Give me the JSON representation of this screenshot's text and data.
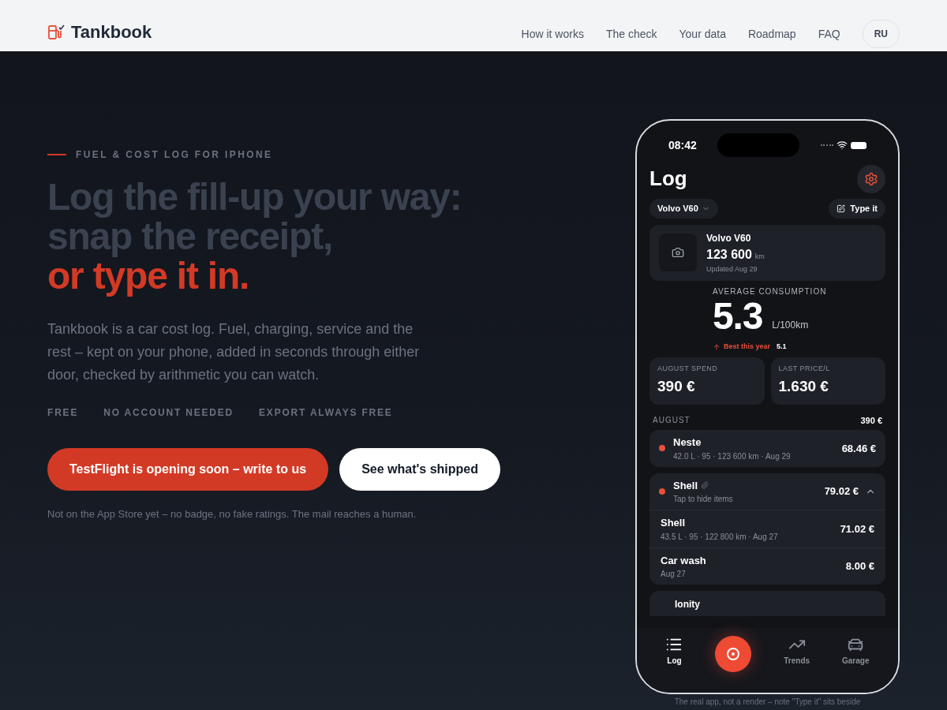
{
  "header": {
    "logo": "Tankbook",
    "nav": [
      "How it works",
      "The check",
      "Your data",
      "Roadmap",
      "FAQ"
    ],
    "language": "RU"
  },
  "hero": {
    "eyebrow": "FUEL & COST LOG FOR IPHONE",
    "headline": [
      {
        "text": "Log the fill-up your way:",
        "accent": false
      },
      {
        "text": "snap the receipt,",
        "accent": false
      },
      {
        "text": "or type it in.",
        "accent": true
      }
    ],
    "intro": "Tankbook is a car cost log. Fuel, charging, service and the rest – kept on your phone, added in seconds through either door, checked by arithmetic you can watch.",
    "features": [
      "FREE",
      "NO ACCOUNT NEEDED",
      "EXPORT ALWAYS FREE"
    ],
    "buttons": [
      {
        "label": "TestFlight is opening soon – write to us",
        "kind": "primary"
      },
      {
        "label": "See what's shipped",
        "kind": "secondary"
      }
    ],
    "note": "Not on the App Store yet – no badge, no fake ratings. The mail reaches a human."
  },
  "phone": {
    "time": "08:42",
    "title": "Log",
    "vehicle_picker": "Volvo V60",
    "type_button": "Type it",
    "car": {
      "name": "Volvo V60",
      "odometer": "123 600",
      "unit": "km",
      "updated": "Updated Aug 29"
    },
    "consumption": {
      "label": "AVERAGE CONSUMPTION",
      "value": "5.3",
      "unit": "L/100km",
      "best_label": "Best this year",
      "best_value": "5.1"
    },
    "stats": [
      {
        "label": "AUGUST SPEND",
        "value": "390 €"
      },
      {
        "label": "LAST PRICE/L",
        "value": "1.630 €"
      }
    ],
    "month": {
      "label": "AUGUST",
      "total": "390 €"
    },
    "entries": [
      {
        "kind": "single",
        "name": "Neste",
        "detail": "42.0 L · 95 · 123 600 km · Aug 29",
        "amount": "68.46 €",
        "color": "#e8503a"
      },
      {
        "kind": "group",
        "name": "Shell",
        "detail": "Tap to hide items",
        "amount": "79.02 €",
        "color": "#e8503a",
        "expanded": true,
        "children": [
          {
            "name": "Shell",
            "detail": "43.5 L · 95 · 122 800 km · Aug 27",
            "amount": "71.02 €"
          },
          {
            "name": "Car wash",
            "detail": "Aug 27",
            "amount": "8.00 €"
          }
        ]
      },
      {
        "kind": "peek",
        "name": "Ionity"
      }
    ],
    "tabs": [
      {
        "kind": "log",
        "label": "Log",
        "selected": true
      },
      {
        "kind": "scan",
        "selected": false
      },
      {
        "kind": "trends",
        "label": "Trends",
        "selected": false
      },
      {
        "kind": "garage",
        "label": "Garage",
        "selected": false
      }
    ]
  },
  "caption": "The real app, not a render – note \"Type it\" sits beside"
}
